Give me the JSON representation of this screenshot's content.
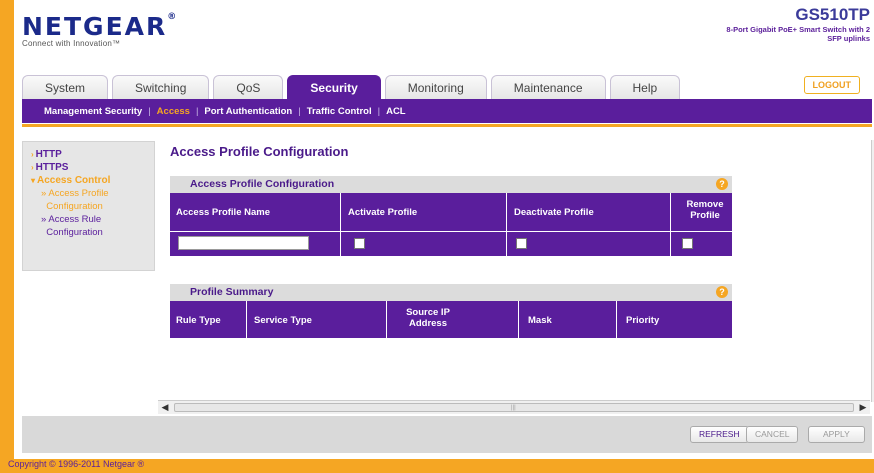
{
  "header": {
    "brand": "NETGEAR",
    "brand_mark": "®",
    "tagline": "Connect with Innovation™",
    "model": "GS510TP",
    "model_desc": "8-Port Gigabit PoE+ Smart Switch with 2 SFP uplinks",
    "logout_label": "LOGOUT"
  },
  "tabs": [
    {
      "label": "System",
      "active": false
    },
    {
      "label": "Switching",
      "active": false
    },
    {
      "label": "QoS",
      "active": false
    },
    {
      "label": "Security",
      "active": true
    },
    {
      "label": "Monitoring",
      "active": false
    },
    {
      "label": "Maintenance",
      "active": false
    },
    {
      "label": "Help",
      "active": false
    }
  ],
  "subnav": {
    "items": [
      "Management Security",
      "Access",
      "Port Authentication",
      "Traffic Control",
      "ACL"
    ],
    "active": "Access"
  },
  "leftmenu": {
    "http": "HTTP",
    "https": "HTTPS",
    "access_control": "Access Control",
    "access_profile_configuration_1": "Access Profile",
    "access_profile_configuration_2": "Configuration",
    "access_rule_configuration_1": "Access Rule",
    "access_rule_configuration_2": "Configuration"
  },
  "main": {
    "page_title": "Access Profile Configuration",
    "config_panel": {
      "title": "Access Profile Configuration",
      "help_icon": "?",
      "columns": [
        "Access Profile Name",
        "Activate Profile",
        "Deactivate Profile",
        "Remove Profile"
      ],
      "profile_name_value": "",
      "activate_checked": false,
      "deactivate_checked": false,
      "remove_checked": false
    },
    "summary_panel": {
      "title": "Profile Summary",
      "help_icon": "?",
      "columns": [
        "Rule Type",
        "Service Type",
        "Source IP Address",
        "Mask",
        "Priority"
      ]
    }
  },
  "buttons": {
    "refresh": "REFRESH",
    "cancel": "CANCEL",
    "apply": "APPLY"
  },
  "footer": "Copyright © 1996-2011 Netgear ®",
  "colors": {
    "purple": "#5a1e9c",
    "orange": "#f5a623",
    "grey_panel": "#dcdcdc"
  }
}
